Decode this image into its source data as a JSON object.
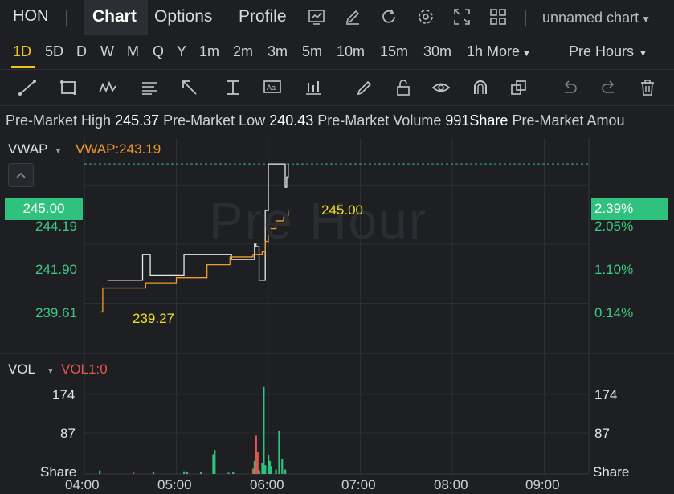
{
  "header": {
    "ticker": "HON",
    "tabs": [
      {
        "label": "Chart",
        "active": true
      },
      {
        "label": "Options",
        "active": false
      },
      {
        "label": "Profile",
        "active": false
      }
    ],
    "tool_icons": [
      "chart-window-icon",
      "edit-icon",
      "refresh-icon",
      "settings-icon",
      "fullscreen-icon",
      "layout-grid-icon"
    ],
    "chart_name": "unnamed chart"
  },
  "timeframes": {
    "items": [
      "1D",
      "5D",
      "D",
      "W",
      "M",
      "Q",
      "Y",
      "1m",
      "2m",
      "3m",
      "5m",
      "10m",
      "15m",
      "30m",
      "1h"
    ],
    "active": "1D",
    "more_label": "More",
    "session_label": "Pre Hours"
  },
  "drawing_tools": [
    "line-tool-icon",
    "rectangle-tool-icon",
    "pattern-tool-icon",
    "fib-tool-icon",
    "arrow-tool-icon",
    "price-range-icon",
    "text-tool-icon",
    "indicator-icon",
    "brush-icon",
    "lock-icon",
    "eye-icon",
    "magnet-icon",
    "copy-icon",
    "undo-icon",
    "redo-icon",
    "delete-icon"
  ],
  "info": {
    "high_label": "Pre-Market High",
    "high_value": "245.37",
    "low_label": "Pre-Market Low",
    "low_value": "240.43",
    "volume_label": "Pre-Market Volume",
    "volume_value": "991Share",
    "amount_label": "Pre-Market Amou"
  },
  "price_panel": {
    "indicator_label": "VWAP",
    "indicator_value": "VWAP:243.19",
    "watermark": "Pre Hour",
    "current_price": "245.00",
    "current_pct": "2.39%",
    "current_price_annot": "245.00",
    "low_annot": "239.27",
    "left_ticks": [
      "244.19",
      "241.90",
      "239.61"
    ],
    "right_ticks": [
      "2.05%",
      "1.10%",
      "0.14%"
    ]
  },
  "volume_panel": {
    "indicator_label": "VOL",
    "indicator_value": "VOL1:0",
    "ticks": [
      "174",
      "87",
      "Share"
    ]
  },
  "time_axis": [
    "04:00",
    "05:00",
    "06:00",
    "07:00",
    "08:00",
    "09:00"
  ],
  "colors": {
    "up": "#2ec27e",
    "down": "#e2584d",
    "vwap": "#f29a2e",
    "price_line": "#e8e8e8",
    "highlight": "#f0c419"
  },
  "chart_data": {
    "type": "line",
    "title": "",
    "xlabel": "",
    "ylabel": "",
    "ylim": [
      238.6,
      246.0
    ],
    "series": [
      {
        "name": "",
        "x": [
          "04:15",
          "04:35",
          "04:38",
          "04:42",
          "04:43",
          "05:04",
          "05:05",
          "05:35",
          "05:36",
          "05:48",
          "05:50",
          "05:51",
          "05:52",
          "05:54",
          "05:57",
          "05:58",
          "06:00",
          "06:02",
          "06:10",
          "06:11",
          "06:12",
          "06:13"
        ],
        "values": [
          240.5,
          240.5,
          241.5,
          241.5,
          240.7,
          240.7,
          241.5,
          241.5,
          241.3,
          241.3,
          241.3,
          241.9,
          241.8,
          240.5,
          240.5,
          243.2,
          245.0,
          245.0,
          245.0,
          244.1,
          244.5,
          245.0
        ]
      },
      {
        "name": "VWAP",
        "x": [
          "04:10",
          "04:12",
          "04:40",
          "05:00",
          "05:20",
          "05:35",
          "05:50",
          "05:56",
          "05:58",
          "06:00",
          "06:05",
          "06:10",
          "06:13"
        ],
        "values": [
          239.27,
          240.2,
          240.4,
          240.6,
          241.1,
          241.4,
          241.5,
          241.6,
          242.0,
          242.5,
          242.8,
          243.0,
          243.19
        ]
      }
    ],
    "volume": {
      "x": [
        "04:10",
        "04:32",
        "04:45",
        "05:05",
        "05:07",
        "05:16",
        "05:24",
        "05:25",
        "05:34",
        "05:37",
        "05:50",
        "05:51",
        "05:52",
        "05:53",
        "05:54",
        "05:56",
        "05:57",
        "05:58",
        "06:00",
        "06:01",
        "06:02",
        "06:05",
        "06:07",
        "06:09",
        "06:11"
      ],
      "values": [
        8,
        3,
        5,
        6,
        4,
        4,
        45,
        55,
        3,
        4,
        12,
        30,
        88,
        50,
        8,
        25,
        200,
        20,
        44,
        30,
        18,
        10,
        100,
        35,
        10
      ],
      "up": [
        true,
        false,
        true,
        true,
        true,
        true,
        true,
        true,
        true,
        true,
        false,
        true,
        false,
        false,
        true,
        true,
        true,
        true,
        true,
        true,
        true,
        true,
        true,
        true,
        true
      ]
    }
  }
}
